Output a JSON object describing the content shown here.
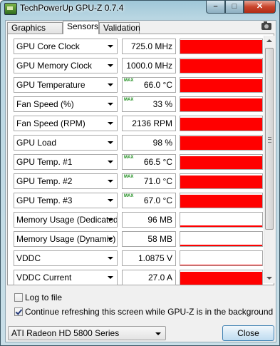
{
  "window": {
    "title": "TechPowerUp GPU-Z 0.7.4"
  },
  "colors": {
    "graph_fill": "#ff0000",
    "max_label": "#1a8c1a"
  },
  "tabs": [
    {
      "label": "Graphics Card",
      "active": false
    },
    {
      "label": "Sensors",
      "active": true
    },
    {
      "label": "Validation",
      "active": false
    }
  ],
  "sensors": [
    {
      "label": "GPU Core Clock",
      "value": "725.0 MHz",
      "max": "",
      "graph_level": 0.95
    },
    {
      "label": "GPU Memory Clock",
      "value": "1000.0 MHz",
      "max": "",
      "graph_level": 0.95
    },
    {
      "label": "GPU Temperature",
      "value": "66.0 °C",
      "max": "MAX",
      "graph_level": 0.9
    },
    {
      "label": "Fan Speed (%)",
      "value": "33 %",
      "max": "MAX",
      "graph_level": 0.9
    },
    {
      "label": "Fan Speed (RPM)",
      "value": "2136 RPM",
      "max": "",
      "graph_level": 0.9
    },
    {
      "label": "GPU Load",
      "value": "98 %",
      "max": "",
      "graph_level": 0.95
    },
    {
      "label": "GPU Temp. #1",
      "value": "66.5 °C",
      "max": "MAX",
      "graph_level": 0.9
    },
    {
      "label": "GPU Temp. #2",
      "value": "71.0 °C",
      "max": "MAX",
      "graph_level": 0.9
    },
    {
      "label": "GPU Temp. #3",
      "value": "67.0 °C",
      "max": "MAX",
      "graph_level": 0.9
    },
    {
      "label": "Memory Usage (Dedicated)",
      "value": "96 MB",
      "max": "",
      "graph_level": 0.1
    },
    {
      "label": "Memory Usage (Dynamic)",
      "value": "58 MB",
      "max": "",
      "graph_level": 0.08
    },
    {
      "label": "VDDC",
      "value": "1.0875 V",
      "max": "",
      "graph_level": 0.06
    },
    {
      "label": "VDDC Current",
      "value": "27.0 A",
      "max": "",
      "graph_level": 0.9
    }
  ],
  "options": {
    "log_to_file": {
      "label": "Log to file",
      "checked": false
    },
    "continue_refresh": {
      "label": "Continue refreshing this screen while GPU-Z is in the background",
      "checked": true
    }
  },
  "device_select": {
    "value": "ATI Radeon HD 5800 Series"
  },
  "close_button": {
    "label": "Close"
  }
}
